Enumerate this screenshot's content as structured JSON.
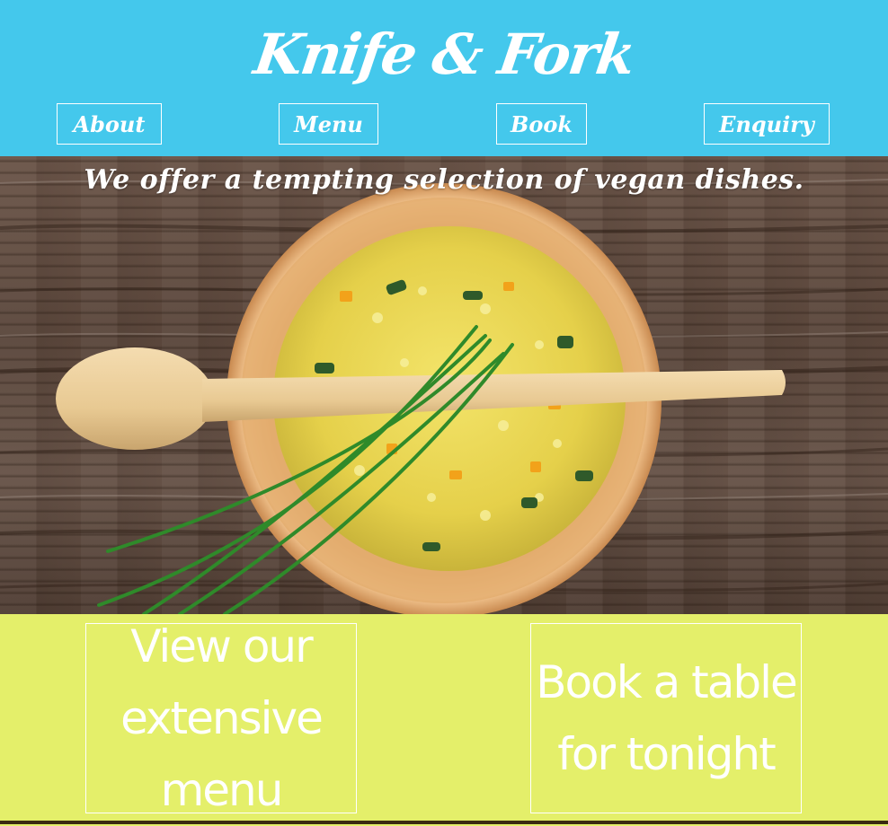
{
  "header": {
    "logo": "Knife & Fork",
    "background": "#44c8ec"
  },
  "nav": {
    "about": "About",
    "menu": "Menu",
    "book": "Book",
    "enquiry": "Enquiry"
  },
  "hero": {
    "tagline": "We offer a tempting selection of vegan dishes."
  },
  "cta": {
    "menu_line1": "View our",
    "menu_line2": "extensive menu",
    "book_line1": "Book a table",
    "book_line2": "for tonight",
    "background": "#e4ef6a"
  }
}
